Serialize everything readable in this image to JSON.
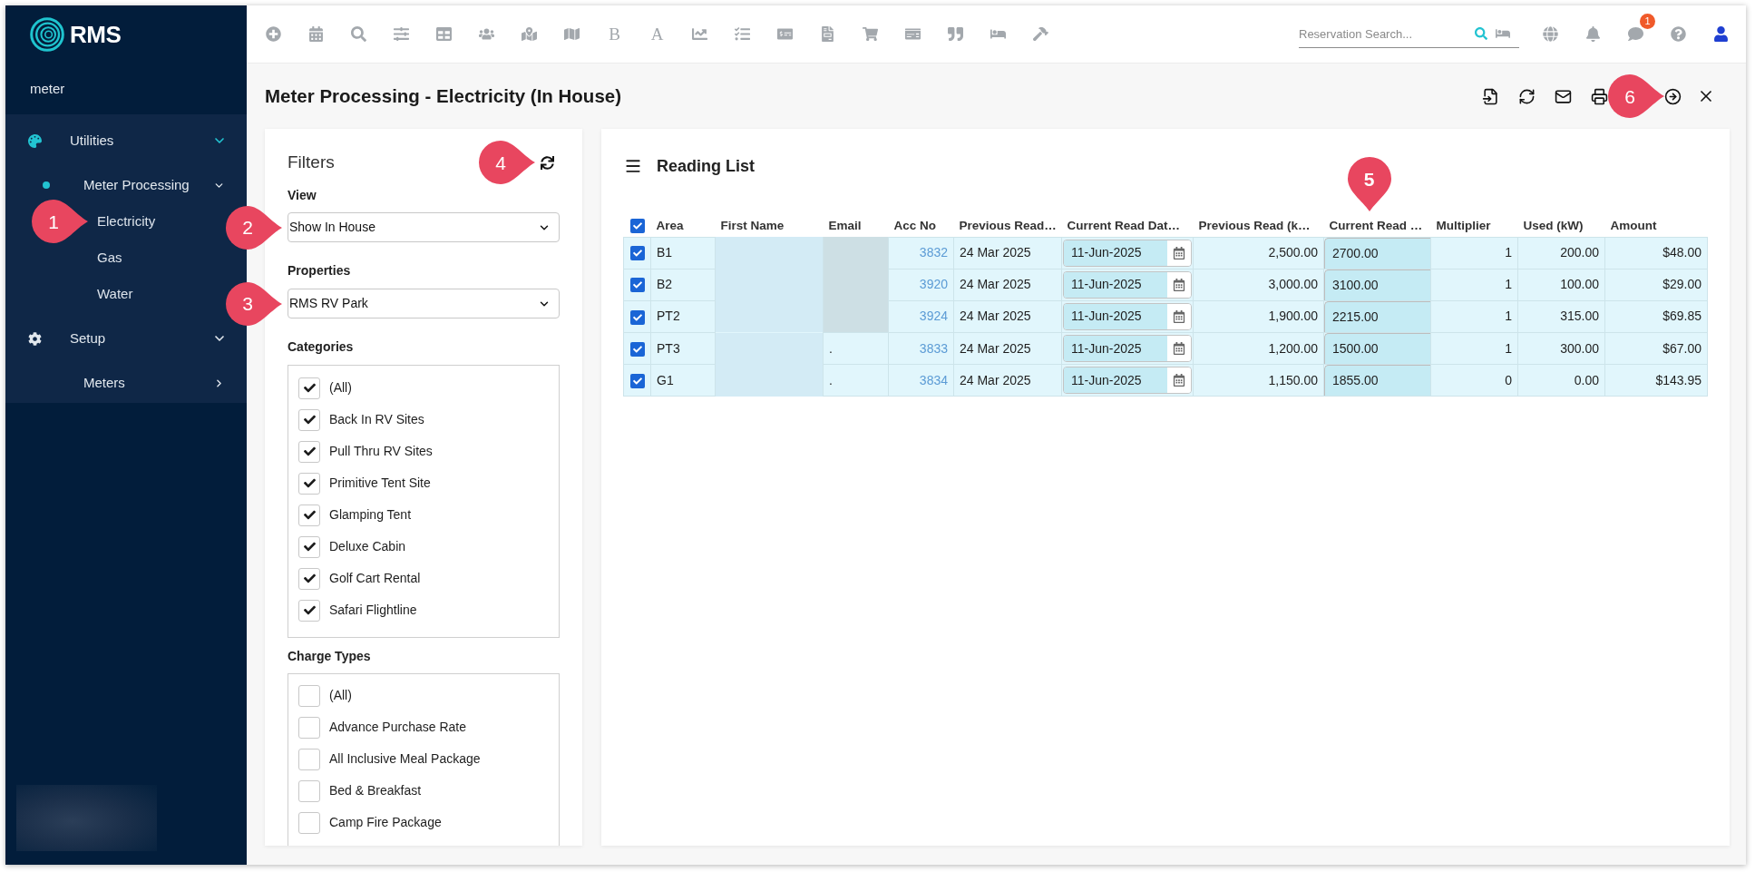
{
  "logo": {
    "text": "RMS"
  },
  "sidebar": {
    "search_value": "meter",
    "menu": [
      {
        "label": "Utilities",
        "active": true,
        "expanded": true,
        "children": [
          {
            "label": "Meter Processing",
            "active": true,
            "expanded": true,
            "children": [
              {
                "label": "Electricity",
                "callout": "1"
              },
              {
                "label": "Gas"
              },
              {
                "label": "Water"
              }
            ]
          }
        ]
      },
      {
        "label": "Setup",
        "active": false,
        "expanded": true,
        "children": [
          {
            "label": "Meters",
            "active": false,
            "expanded": false
          }
        ]
      }
    ]
  },
  "toolbar": {
    "letters": [
      "B",
      "A"
    ],
    "search": {
      "placeholder": "Reservation Search..."
    },
    "notification_badge": "1"
  },
  "page": {
    "title": "Meter Processing - Electricity (In House)",
    "action_callout": "6"
  },
  "filters": {
    "title": "Filters",
    "refresh_callout": "4",
    "view": {
      "label": "View",
      "value": "Show In House",
      "callout": "2"
    },
    "properties": {
      "label": "Properties",
      "value": "RMS RV Park",
      "callout": "3"
    },
    "categories": {
      "label": "Categories",
      "items": [
        {
          "label": "(All)",
          "checked": true
        },
        {
          "label": "Back In RV Sites",
          "checked": true
        },
        {
          "label": "Pull Thru RV Sites",
          "checked": true
        },
        {
          "label": "Primitive Tent Site",
          "checked": true
        },
        {
          "label": "Glamping Tent",
          "checked": true
        },
        {
          "label": "Deluxe Cabin",
          "checked": true
        },
        {
          "label": "Golf Cart Rental",
          "checked": true
        },
        {
          "label": "Safari Flightline",
          "checked": true
        }
      ]
    },
    "charge_types": {
      "label": "Charge Types",
      "items": [
        {
          "label": "(All)",
          "checked": false
        },
        {
          "label": "Advance Purchase Rate",
          "checked": false
        },
        {
          "label": "All Inclusive Meal Package",
          "checked": false
        },
        {
          "label": "Bed & Breakfast",
          "checked": false
        },
        {
          "label": "Camp Fire Package",
          "checked": false
        }
      ]
    }
  },
  "reading_list": {
    "title": "Reading List",
    "table": {
      "select_all_checked": true,
      "columns": [
        {
          "label": "Area"
        },
        {
          "label": "First Name"
        },
        {
          "label": "Email"
        },
        {
          "label": "Acc No"
        },
        {
          "label": "Previous Read…"
        },
        {
          "label": "Current Read Dat…"
        },
        {
          "label": "Previous Read (k…"
        },
        {
          "label": "Current Read …",
          "callout": "5"
        },
        {
          "label": "Multiplier"
        },
        {
          "label": "Used (kW)"
        },
        {
          "label": "Amount"
        }
      ],
      "rows": [
        {
          "selected": true,
          "area": "B1",
          "first_name_redacted": true,
          "email_redacted": true,
          "acc_no": "3832",
          "previous_read_date": "24 Mar 2025",
          "current_read_date": "11-Jun-2025",
          "previous_read": "2,500.00",
          "current_read": "2700.00",
          "multiplier": "1",
          "used": "200.00",
          "amount": "$48.00"
        },
        {
          "selected": true,
          "area": "B2",
          "first_name_redacted": true,
          "email_redacted": true,
          "acc_no": "3920",
          "previous_read_date": "24 Mar 2025",
          "current_read_date": "11-Jun-2025",
          "previous_read": "3,000.00",
          "current_read": "3100.00",
          "multiplier": "1",
          "used": "100.00",
          "amount": "$29.00"
        },
        {
          "selected": true,
          "area": "PT2",
          "first_name_redacted": true,
          "email_redacted": true,
          "acc_no": "3924",
          "previous_read_date": "24 Mar 2025",
          "current_read_date": "11-Jun-2025",
          "previous_read": "1,900.00",
          "current_read": "2215.00",
          "multiplier": "1",
          "used": "315.00",
          "amount": "$69.85"
        },
        {
          "selected": true,
          "area": "PT3",
          "first_name_redacted": true,
          "email_redacted": false,
          "email": ".",
          "acc_no": "3833",
          "previous_read_date": "24 Mar 2025",
          "current_read_date": "11-Jun-2025",
          "previous_read": "1,200.00",
          "current_read": "1500.00",
          "multiplier": "1",
          "used": "300.00",
          "amount": "$67.00"
        },
        {
          "selected": true,
          "area": "G1",
          "first_name_redacted": true,
          "email_redacted": false,
          "email": ".",
          "acc_no": "3834",
          "previous_read_date": "24 Mar 2025",
          "current_read_date": "11-Jun-2025",
          "previous_read": "1,150.00",
          "current_read": "1855.00",
          "multiplier": "0",
          "used": "0.00",
          "amount": "$143.95"
        }
      ]
    }
  }
}
